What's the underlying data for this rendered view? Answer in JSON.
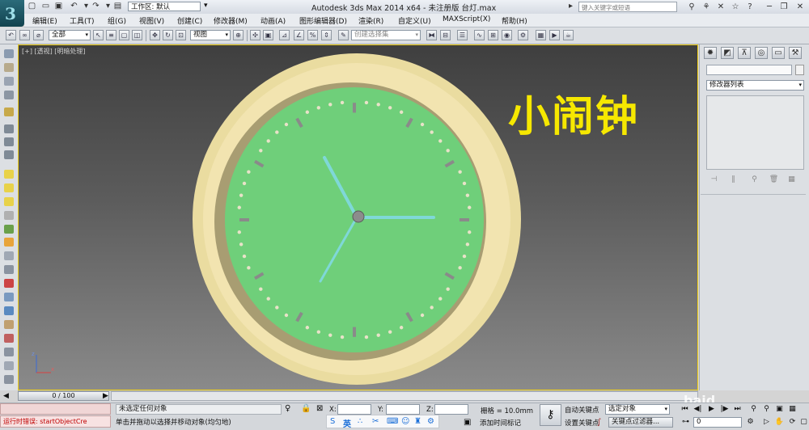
{
  "title_bar": {
    "workspace_label": "工作区: 默认",
    "app_title": "Autodesk 3ds Max  2014 x64  - 未注册版   台灯.max",
    "search_placeholder": "键入关键字或短语"
  },
  "menu": {
    "items": [
      "编辑(E)",
      "工具(T)",
      "组(G)",
      "视图(V)",
      "创建(C)",
      "修改器(M)",
      "动画(A)",
      "图形编辑器(D)",
      "渲染(R)",
      "自定义(U)",
      "MAXScript(X)",
      "帮助(H)"
    ]
  },
  "toolbar": {
    "filter_value": "全部",
    "coord_value": "视图",
    "named_selection_placeholder": "创建选择集"
  },
  "viewport": {
    "label": "[+] [透视] [明暗处理]",
    "overlay_title": "小闹钟",
    "axis_x": "x",
    "axis_z": "z"
  },
  "command_panel": {
    "modifier_list_label": "修改器列表"
  },
  "timeline": {
    "slider_label": "0 / 100"
  },
  "status": {
    "listener_error": "运行时错误: startObjectCre",
    "prompt_line": "未选定任何对象",
    "hint_line": "单击并拖动以选择并移动对象(均匀地)",
    "x_label": "X:",
    "y_label": "Y:",
    "z_label": "Z:",
    "grid_label": "栅格 = 10.0mm",
    "add_time_tag": "添加时间标记",
    "auto_key": "自动关键点",
    "set_key": "设置关键点",
    "selection_filter": "选定对象",
    "key_filters": "关键点过滤器...",
    "frame_value": "0",
    "ime_lang": "英",
    "watermark": "baid"
  },
  "colors": {
    "viewport_border": "#f2d11a",
    "clock_face": "#6fcf7a",
    "clock_rim": "#f0e0a0",
    "clock_hands": "#7fd8d8",
    "title_text": "#f6e800",
    "error_text": "#c00000"
  }
}
